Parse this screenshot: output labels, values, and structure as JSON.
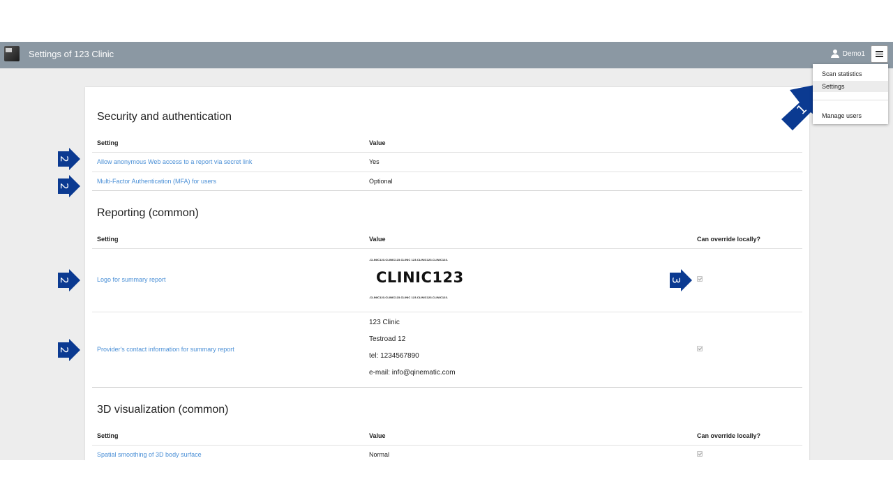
{
  "header": {
    "title": "Settings of 123 Clinic",
    "user_name": "Demo1"
  },
  "menu": {
    "items": [
      {
        "label": "Scan statistics"
      },
      {
        "label": "Settings",
        "active": true
      },
      {
        "label": "Manage users"
      }
    ]
  },
  "security": {
    "title": "Security and authentication",
    "col_setting": "Setting",
    "col_value": "Value",
    "rows": [
      {
        "setting": "Allow anonymous Web access to a report via secret link",
        "value": "Yes"
      },
      {
        "setting": "Multi-Factor Authentication (MFA) for users",
        "value": "Optional"
      }
    ]
  },
  "reporting": {
    "title": "Reporting (common)",
    "col_setting": "Setting",
    "col_value": "Value",
    "col_override": "Can override locally?",
    "logo_setting": "Logo for summary report",
    "logo_text": "CLINIC123",
    "logo_strip": ".CLINIC123.CLINIC123.CLINIC 123.CLINIC123.CLINIC123.",
    "logo_override": true,
    "contact_setting": "Provider's contact information for summary report",
    "contact_lines": [
      "123 Clinic",
      "Testroad 12",
      "tel: 1234567890",
      "e-mail: info@qinematic.com"
    ],
    "contact_override": true
  },
  "visualization": {
    "title": "3D visualization (common)",
    "col_setting": "Setting",
    "col_value": "Value",
    "col_override": "Can override locally?",
    "rows": [
      {
        "setting": "Spatial smoothing of 3D body surface",
        "value": "Normal",
        "override": true
      }
    ]
  },
  "markers": {
    "menu": "1",
    "settings": "2",
    "override": "3"
  },
  "colors": {
    "topbar": "#8b98a3",
    "link": "#4a8fd6",
    "marker": "#0b3a91"
  }
}
